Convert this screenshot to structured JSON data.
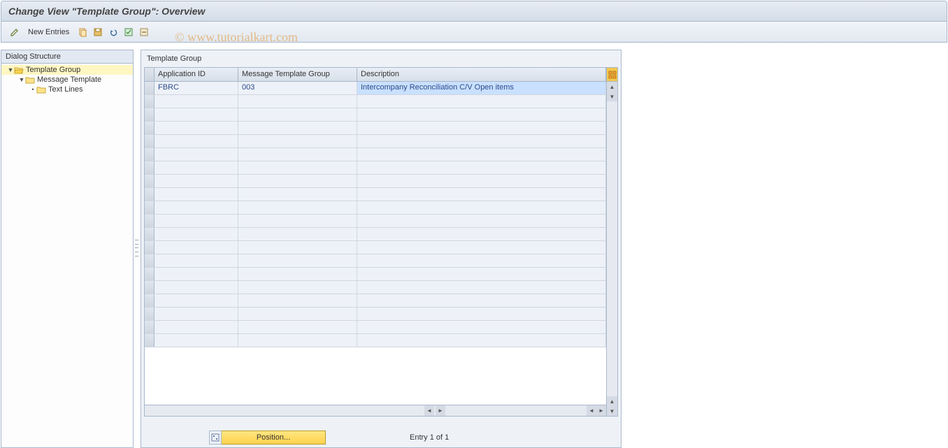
{
  "title": "Change View \"Template Group\": Overview",
  "watermark": "© www.tutorialkart.com",
  "toolbar": {
    "new_entries_label": "New Entries"
  },
  "tree": {
    "header": "Dialog Structure",
    "items": [
      {
        "label": "Template Group",
        "level": 0,
        "expanded": true,
        "open": true,
        "selected": true
      },
      {
        "label": "Message Template",
        "level": 1,
        "expanded": true,
        "open": false,
        "selected": false
      },
      {
        "label": "Text Lines",
        "level": 2,
        "expanded": false,
        "open": false,
        "selected": false
      }
    ]
  },
  "grid": {
    "group_label": "Template Group",
    "columns": [
      "Application ID",
      "Message Template Group",
      "Description"
    ],
    "rows": [
      {
        "app_id": "FBRC",
        "msg_grp": "003",
        "desc": "Intercompany Reconciliation C/V Open items"
      }
    ],
    "empty_row_count": 19
  },
  "footer": {
    "position_label": "Position...",
    "entry_text": "Entry 1 of 1"
  }
}
